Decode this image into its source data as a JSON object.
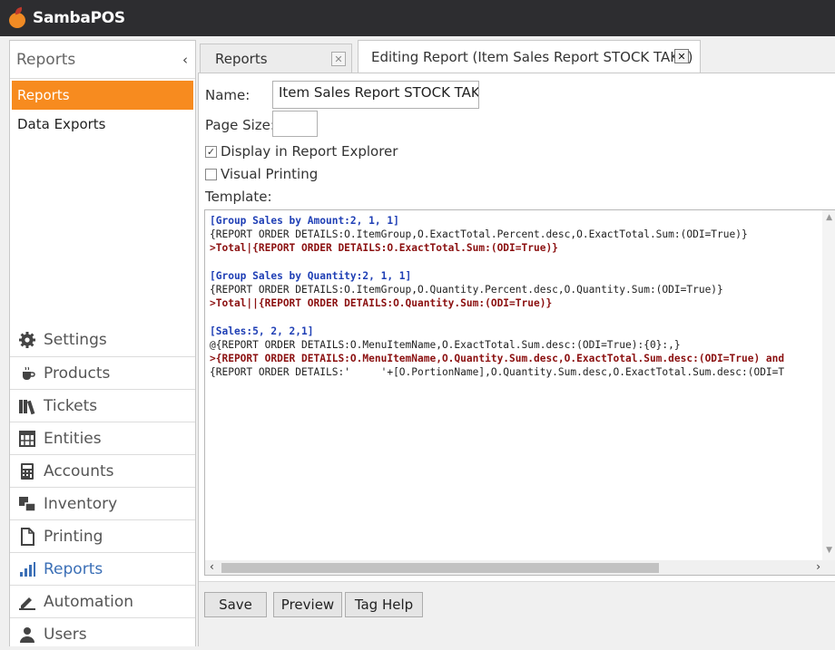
{
  "app": {
    "brand": "SambaPOS"
  },
  "sidebar": {
    "header": "Reports",
    "collapse_glyph": "‹",
    "items": [
      {
        "label": "Reports",
        "active": true
      },
      {
        "label": "Data Exports",
        "active": false
      }
    ],
    "nav": [
      {
        "label": "Settings",
        "icon": "gear-icon"
      },
      {
        "label": "Products",
        "icon": "coffee-cup-icon"
      },
      {
        "label": "Tickets",
        "icon": "books-icon"
      },
      {
        "label": "Entities",
        "icon": "table-grid-icon"
      },
      {
        "label": "Accounts",
        "icon": "calculator-icon"
      },
      {
        "label": "Inventory",
        "icon": "inventory-icon"
      },
      {
        "label": "Printing",
        "icon": "document-icon"
      },
      {
        "label": "Reports",
        "icon": "bar-chart-icon"
      },
      {
        "label": "Automation",
        "icon": "pen-icon"
      },
      {
        "label": "Users",
        "icon": "user-icon"
      }
    ]
  },
  "tabs": [
    {
      "label": "Reports"
    },
    {
      "label": "Editing Report (Item Sales Report STOCK TAKE)"
    }
  ],
  "form": {
    "name_label": "Name:",
    "name_value": "Item Sales Report STOCK TAKE",
    "page_size_label": "Page Size:",
    "page_size_value": "",
    "display_in_explorer_label": "Display in Report Explorer",
    "display_in_explorer_checked": true,
    "visual_printing_label": "Visual Printing",
    "visual_printing_checked": false,
    "template_label": "Template:"
  },
  "template_lines": [
    {
      "kind": "header",
      "text": "[Group Sales by Amount:2, 1, 1]"
    },
    {
      "kind": "plain",
      "text": "{REPORT ORDER DETAILS:O.ItemGroup,O.ExactTotal.Percent.desc,O.ExactTotal.Sum:(ODI=True)}"
    },
    {
      "kind": "total",
      "text": ">Total|{REPORT ORDER DETAILS:O.ExactTotal.Sum:(ODI=True)}"
    },
    {
      "kind": "blank",
      "text": ""
    },
    {
      "kind": "header",
      "text": "[Group Sales by Quantity:2, 1, 1]"
    },
    {
      "kind": "plain",
      "text": "{REPORT ORDER DETAILS:O.ItemGroup,O.Quantity.Percent.desc,O.Quantity.Sum:(ODI=True)}"
    },
    {
      "kind": "total",
      "text": ">Total||{REPORT ORDER DETAILS:O.Quantity.Sum:(ODI=True)}"
    },
    {
      "kind": "blank",
      "text": ""
    },
    {
      "kind": "header",
      "text": "[Sales:5, 2, 2,1]"
    },
    {
      "kind": "plain",
      "text": "@{REPORT ORDER DETAILS:O.MenuItemName,O.ExactTotal.Sum.desc:(ODI=True):{0}:,}"
    },
    {
      "kind": "total",
      "text": ">{REPORT ORDER DETAILS:O.MenuItemName,O.Quantity.Sum.desc,O.ExactTotal.Sum.desc:(ODI=True) and"
    },
    {
      "kind": "plain",
      "text": "{REPORT ORDER DETAILS:'     '+[O.PortionName],O.Quantity.Sum.desc,O.ExactTotal.Sum.desc:(ODI=T"
    }
  ],
  "buttons": {
    "save": "Save",
    "preview": "Preview",
    "tag_help": "Tag Help"
  },
  "colors": {
    "accent": "#f78b1f",
    "titlebar": "#2d2d30",
    "link": "#3b6fb6"
  }
}
